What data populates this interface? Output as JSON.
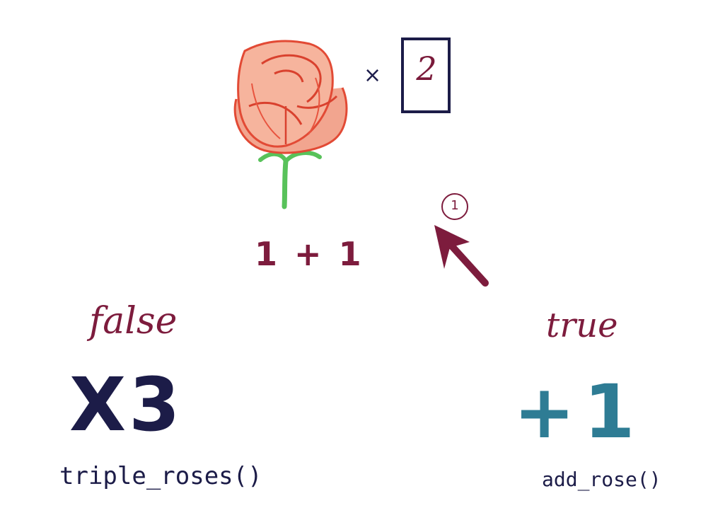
{
  "top": {
    "multiplier_symbol": "×",
    "boxed_value": "2",
    "expression": "1 + 1",
    "step_number": "1"
  },
  "branches": {
    "false": {
      "label": "false",
      "operation": "X3",
      "function_call": "triple_roses()"
    },
    "true": {
      "label": "true",
      "operation": "+1",
      "function_call": "add_rose()"
    }
  },
  "colors": {
    "maroon": "#7d1c3d",
    "navy": "#1c1c48",
    "teal": "#2e7c94",
    "rose_red": "#e8543f",
    "stem_green": "#58c25a"
  },
  "icons": {
    "rose": "rose-icon",
    "arrow": "arrow-icon",
    "box": "value-box"
  }
}
